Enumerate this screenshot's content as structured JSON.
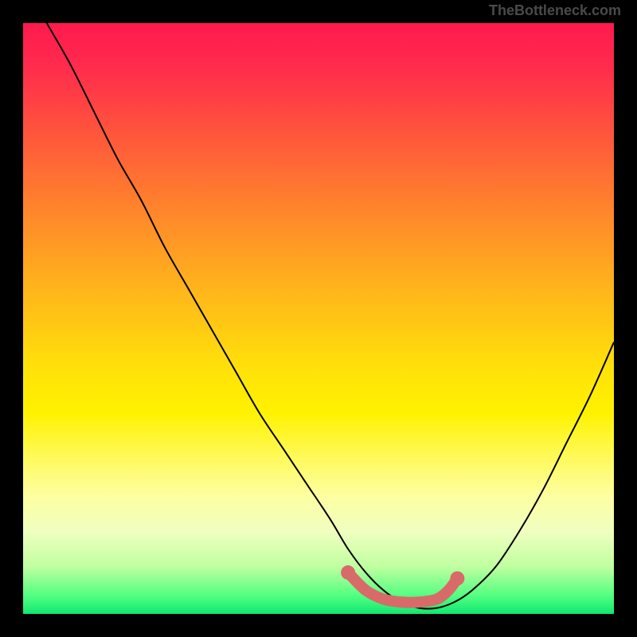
{
  "watermark": "TheBottleneck.com",
  "chart_data": {
    "type": "line",
    "title": "",
    "xlabel": "",
    "ylabel": "",
    "xlim": [
      0,
      100
    ],
    "ylim": [
      0,
      100
    ],
    "series": [
      {
        "name": "bottleneck-curve",
        "x": [
          4,
          8,
          12,
          16,
          20,
          24,
          28,
          32,
          36,
          40,
          44,
          48,
          52,
          55,
          58,
          61,
          64,
          67,
          70,
          73,
          76,
          80,
          84,
          88,
          92,
          96,
          100
        ],
        "y": [
          100,
          93,
          85,
          77,
          70,
          62,
          55,
          48,
          41,
          34,
          28,
          22,
          16,
          11,
          7,
          4,
          2,
          1,
          1,
          2,
          4,
          8,
          14,
          21,
          29,
          37,
          46
        ]
      }
    ],
    "marker_region": {
      "name": "optimal-zone",
      "points": [
        {
          "x": 55,
          "y": 7
        },
        {
          "x": 58,
          "y": 4
        },
        {
          "x": 61,
          "y": 2.5
        },
        {
          "x": 64,
          "y": 2
        },
        {
          "x": 67,
          "y": 2
        },
        {
          "x": 70,
          "y": 2.5
        },
        {
          "x": 72,
          "y": 4
        },
        {
          "x": 73.5,
          "y": 6
        }
      ]
    },
    "background": "rainbow-gradient-vertical"
  }
}
